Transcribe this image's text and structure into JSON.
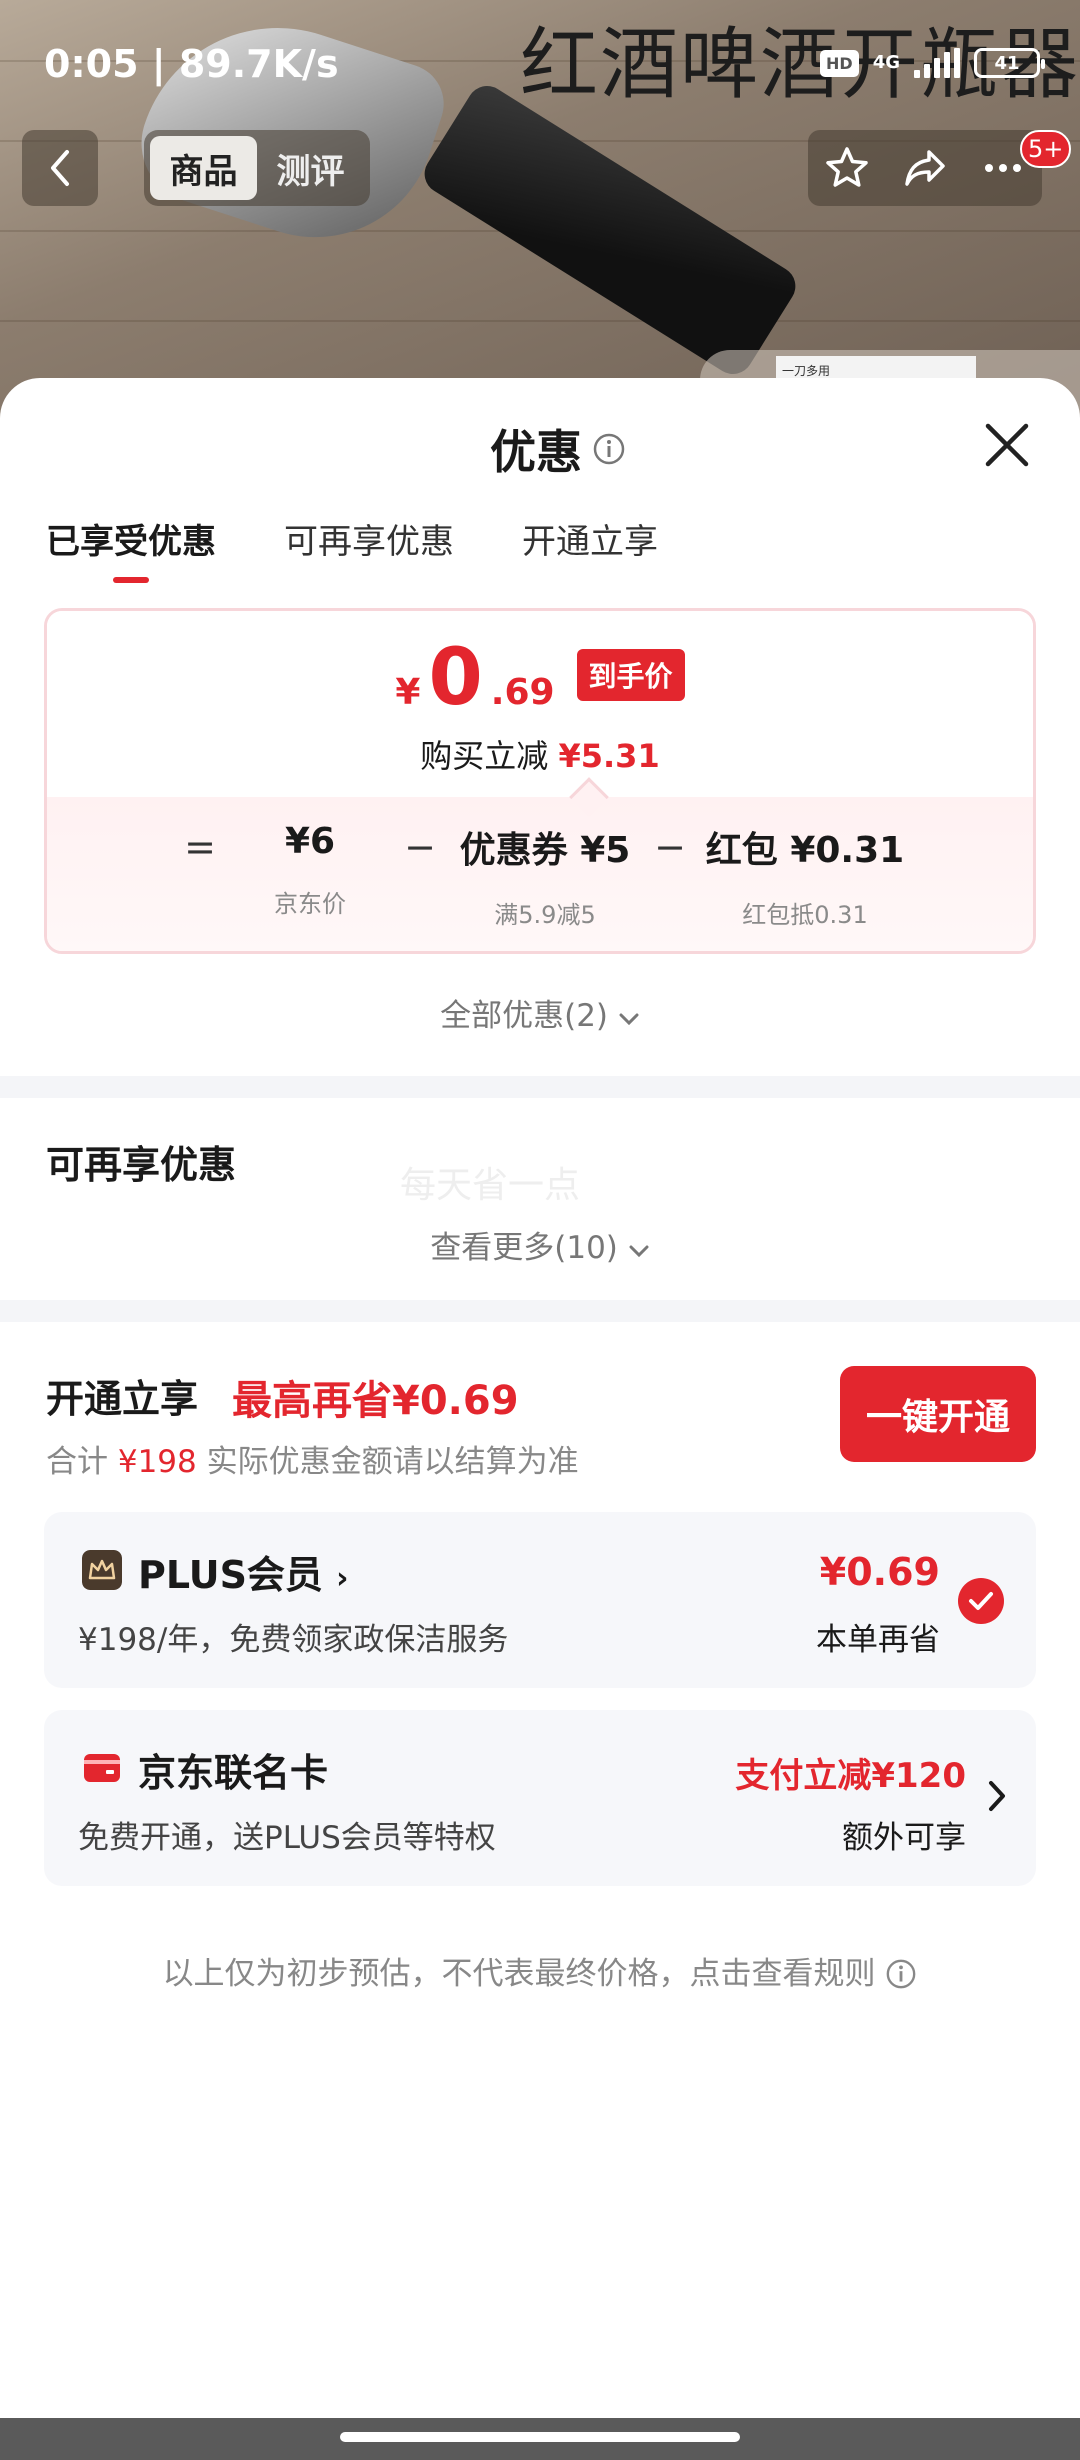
{
  "status_bar": {
    "time_speed": "0:05 | 89.7K/s",
    "hd": "HD",
    "network": "4G",
    "battery": "41"
  },
  "product_overlay_title": "红酒啤酒开瓶器",
  "top_nav": {
    "tabs": [
      "商品",
      "测评"
    ],
    "message_badge": "5+"
  },
  "mini_thumb_text": "一刀多用",
  "sheet": {
    "title": "优惠",
    "tabs": [
      "已享受优惠",
      "可再享优惠",
      "开通立享"
    ],
    "price": {
      "currency": "¥",
      "integer": "0",
      "decimal": ".69",
      "tag": "到手价",
      "sub_prefix": "购买立减",
      "sub_amount": "¥5.31"
    },
    "calc": {
      "eq": "=",
      "minus": "−",
      "items": [
        {
          "value": "¥6",
          "note": "京东价"
        },
        {
          "value": "优惠券 ¥5",
          "note": "满5.9减5"
        },
        {
          "value": "红包 ¥0.31",
          "note": "红包抵0.31"
        }
      ]
    },
    "all_discounts": "全部优惠(2)",
    "section2": {
      "title": "可再享优惠",
      "watermark": "每天省一点",
      "view_more": "查看更多(10)"
    },
    "open": {
      "title": "开通立享",
      "max_save": "最高再省¥0.69",
      "sub_prefix": "合计",
      "sub_amount": "¥198",
      "sub_suffix": "实际优惠金额请以结算为准",
      "button": "一键开通"
    },
    "plus_card": {
      "name": "PLUS会员",
      "desc": "¥198/年，免费领家政保洁服务",
      "amount": "¥0.69",
      "label": "本单再省"
    },
    "jd_card": {
      "name": "京东联名卡",
      "desc": "免费开通，送PLUS会员等特权",
      "amount": "支付立减¥120",
      "label": "额外可享"
    },
    "footnote": "以上仅为初步预估，不代表最终价格，点击查看规则"
  },
  "colors": {
    "accent": "#e3262e",
    "card_bg": "#f6f7fa",
    "price_border": "#f7d6da"
  },
  "icons": [
    "back-arrow-icon",
    "star-icon",
    "share-icon",
    "more-icon",
    "info-icon",
    "close-icon",
    "chevron-down-icon",
    "crown-icon",
    "card-icon",
    "check-icon",
    "chevron-right-icon"
  ]
}
